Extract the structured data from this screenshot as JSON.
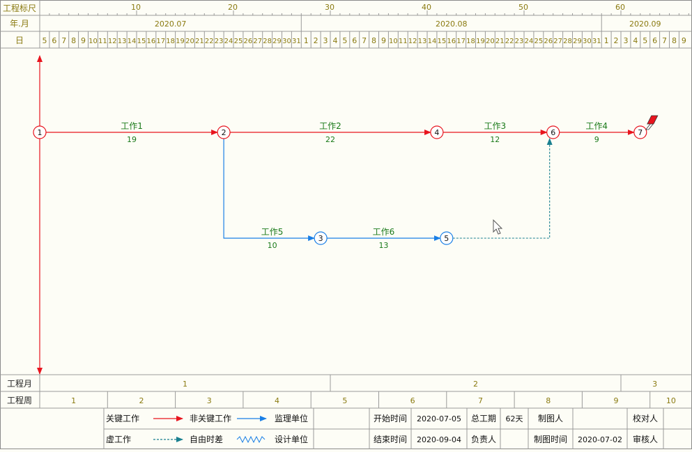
{
  "header": {
    "ruler_label": "工程标尺",
    "month_label": "年.月",
    "day_label": "日",
    "ruler_ticks": [
      "10",
      "20",
      "30",
      "40",
      "50",
      "60"
    ],
    "months": [
      "2020.07",
      "2020.08",
      "2020.09"
    ],
    "days": [
      "5",
      "6",
      "7",
      "8",
      "9",
      "10",
      "11",
      "12",
      "13",
      "14",
      "15",
      "16",
      "17",
      "18",
      "19",
      "20",
      "21",
      "22",
      "23",
      "24",
      "25",
      "26",
      "27",
      "28",
      "29",
      "30",
      "31",
      "1",
      "2",
      "3",
      "4",
      "5",
      "6",
      "7",
      "8",
      "9",
      "10",
      "11",
      "12",
      "13",
      "14",
      "15",
      "16",
      "17",
      "18",
      "19",
      "20",
      "21",
      "22",
      "23",
      "24",
      "25",
      "26",
      "27",
      "28",
      "29",
      "30",
      "31",
      "1",
      "2",
      "3",
      "4",
      "5",
      "6",
      "7",
      "8",
      "9"
    ]
  },
  "network": {
    "nodes": [
      {
        "id": "1",
        "type": "critical",
        "day": 0,
        "row": "main"
      },
      {
        "id": "2",
        "type": "critical",
        "day": 19,
        "row": "main"
      },
      {
        "id": "4",
        "type": "critical",
        "day": 41,
        "row": "main"
      },
      {
        "id": "6",
        "type": "critical",
        "day": 53,
        "row": "main"
      },
      {
        "id": "7",
        "type": "critical",
        "day": 62,
        "row": "main"
      },
      {
        "id": "3",
        "type": "noncritical",
        "day": 29,
        "row": "lower"
      },
      {
        "id": "5",
        "type": "noncritical",
        "day": 42,
        "row": "lower"
      }
    ],
    "activities": [
      {
        "name": "工作1",
        "duration": "19",
        "from": "1",
        "to": "2",
        "type": "critical"
      },
      {
        "name": "工作2",
        "duration": "22",
        "from": "2",
        "to": "4",
        "type": "critical"
      },
      {
        "name": "工作3",
        "duration": "12",
        "from": "4",
        "to": "6",
        "type": "critical"
      },
      {
        "name": "工作4",
        "duration": "9",
        "from": "6",
        "to": "7",
        "type": "critical"
      },
      {
        "name": "工作5",
        "duration": "10",
        "from": "2",
        "to": "3",
        "type": "noncritical"
      },
      {
        "name": "工作6",
        "duration": "13",
        "from": "3",
        "to": "5",
        "type": "noncritical"
      }
    ],
    "dummy": {
      "from": "5",
      "to": "6"
    }
  },
  "footer": {
    "month_row_label": "工程月",
    "week_row_label": "工程周",
    "months": [
      "1",
      "2",
      "3"
    ],
    "weeks": [
      "1",
      "2",
      "3",
      "4",
      "5",
      "6",
      "7",
      "8",
      "9",
      "10"
    ]
  },
  "legend": {
    "critical": "关键工作",
    "noncritical": "非关键工作",
    "supervisor": "监理单位",
    "dummy": "虚工作",
    "free_float": "自由时差",
    "designer": "设计单位"
  },
  "info": {
    "start_label": "开始时间",
    "start_value": "2020-07-05",
    "end_label": "结束时间",
    "end_value": "2020-09-04",
    "duration_label": "总工期",
    "duration_value": "62天",
    "owner_label": "负责人",
    "drafter_label": "制图人",
    "draw_time_label": "制图时间",
    "draw_time_value": "2020-07-02",
    "checker_label": "校对人",
    "reviewer_label": "审核人"
  },
  "colors": {
    "critical": "#e8141e",
    "noncritical": "#1a7fe6",
    "dummy": "#1a8090",
    "header_text": "#8a7a10",
    "label_text": "#1a7a1a",
    "grid": "#8a8a8a"
  }
}
